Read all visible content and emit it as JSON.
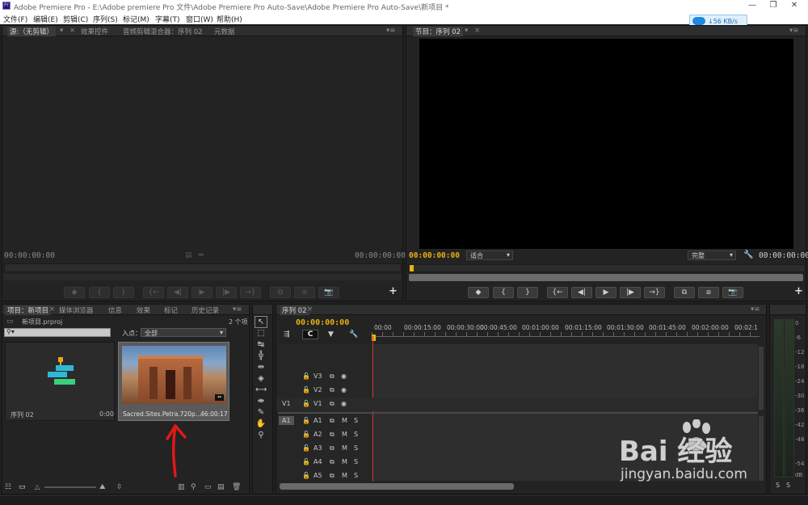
{
  "window": {
    "title": "Adobe Premiere Pro - E:\\Adobe premiere Pro 文件\\Adobe Premiere Pro Auto-Save\\Adobe Premiere Pro Auto-Save\\新项目 *",
    "app_icon": "Pr",
    "controls": [
      "—",
      "❐",
      "✕"
    ]
  },
  "menu": [
    "文件(F)",
    "编辑(E)",
    "剪辑(C)",
    "序列(S)",
    "标记(M)",
    "字幕(T)",
    "窗口(W)",
    "帮助(H)"
  ],
  "net_widget": {
    "speed": "↓56 KB/s"
  },
  "source_panel": {
    "tabs": [
      "源:（无剪辑）",
      "效果控件",
      "音频剪辑混合器：序列 02",
      "元数据"
    ],
    "timecode_left": "00:00:00:00",
    "timecode_right": "00:00:00:00"
  },
  "program_panel": {
    "tab": "节目：序列 02",
    "timecode_left": "00:00:00:00",
    "fit": "适合",
    "quality": "完整",
    "timecode_right": "00:00:00:00",
    "plus": "+"
  },
  "transport": [
    "◆",
    "{",
    "}",
    "{←",
    "◀|",
    "▶",
    "|▶",
    "→}",
    "⧉",
    "⧈",
    "📷"
  ],
  "project_panel": {
    "tabs": [
      "项目：新项目",
      "媒体浏览器",
      "信息",
      "效果",
      "标记",
      "历史记录"
    ],
    "filename": "新项目.prproj",
    "item_count": "2 个项",
    "inpoint_label": "入点：",
    "inpoint_value": "全部",
    "items": [
      {
        "name": "序列 02",
        "duration": "0:00"
      },
      {
        "name": "Sacred.Sites.Petra.720p...",
        "duration": "46:00:17"
      }
    ]
  },
  "timeline": {
    "tab": "序列 02",
    "timecode": "00:00:00:00",
    "ruler": [
      "00:00",
      "00:00:15:00",
      "00:00:30:00",
      "00:00:45:00",
      "00:01:00:00",
      "00:01:15:00",
      "00:01:30:00",
      "00:01:45:00",
      "00:02:00:00",
      "00:02:1"
    ],
    "video_tracks": [
      "V3",
      "V2",
      "V1"
    ],
    "audio_tracks": [
      "A1",
      "A2",
      "A3",
      "A4",
      "A5"
    ],
    "src_v": "V1",
    "src_a": "A1",
    "mute": "M",
    "solo": "S"
  },
  "meter": {
    "labels": [
      "0",
      "-6",
      "-12",
      "-18",
      "-24",
      "-30",
      "-36",
      "-42",
      "-48",
      "-54",
      "dB"
    ],
    "solo_buttons": [
      "S",
      "S"
    ]
  },
  "watermark": {
    "brand": "Bai 经验",
    "url": "jingyan.baidu.com"
  }
}
